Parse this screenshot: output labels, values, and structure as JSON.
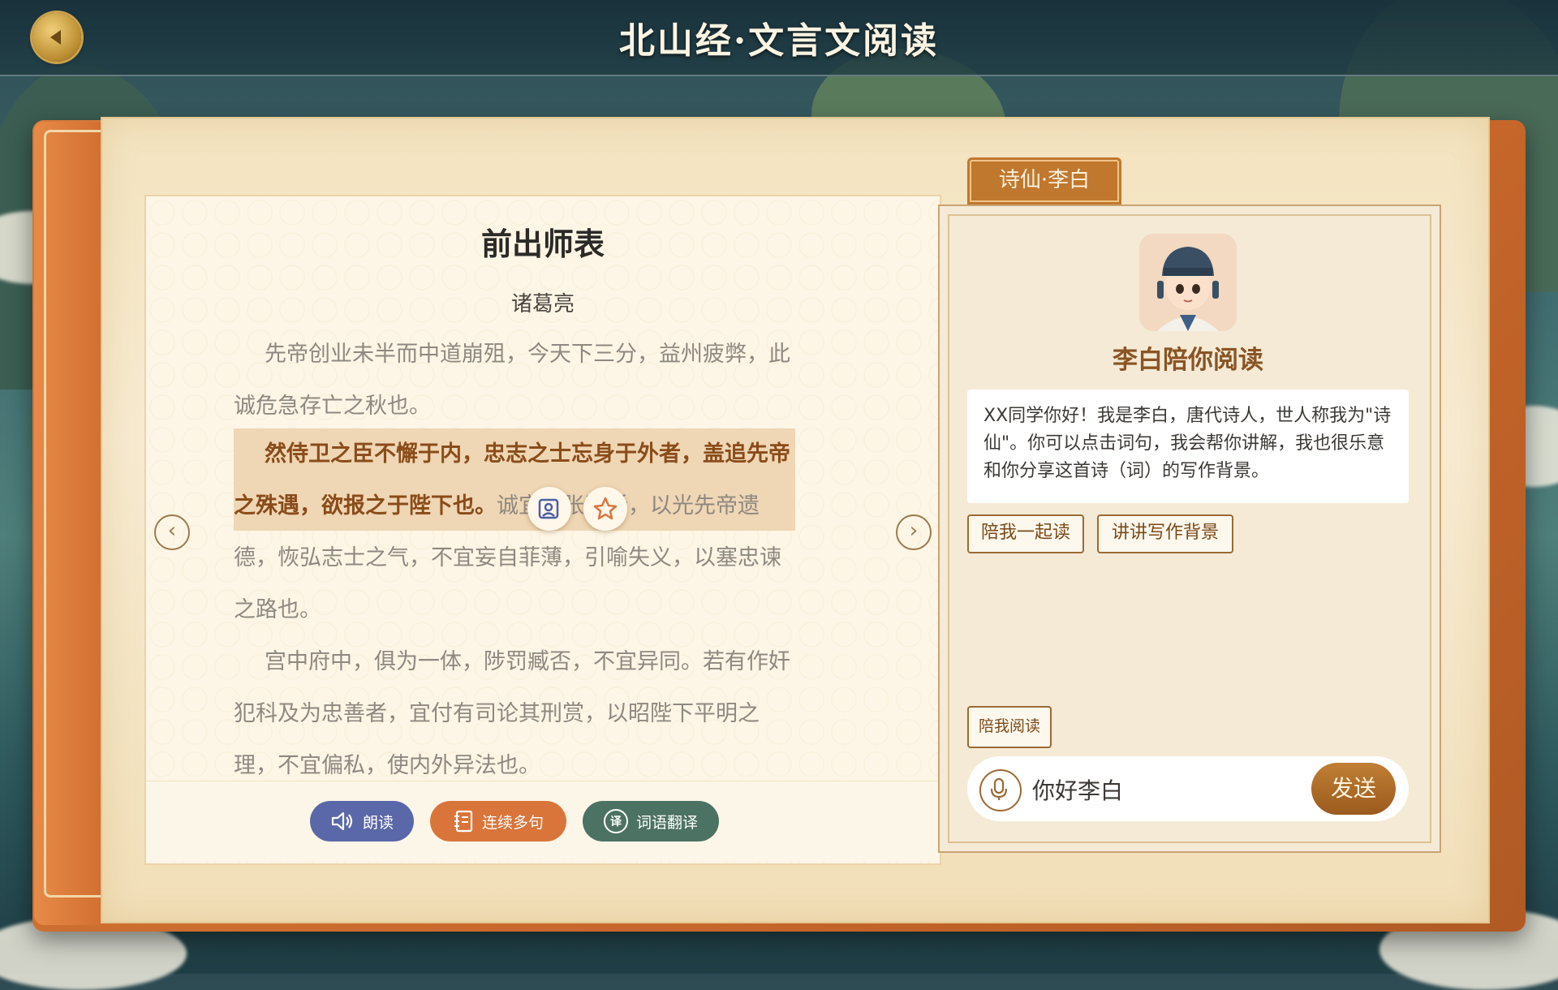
{
  "header": {
    "title": "北山经·文言文阅读",
    "back_icon": "back-arrow-icon"
  },
  "reader": {
    "title": "前出师表",
    "author": "诸葛亮",
    "paragraphs": [
      "先帝创业未半而中道崩殂，今天下三分，益州疲弊，此诚危急存亡之秋也。",
      "然侍卫之臣不懈于内，忠志之士忘身于外者，盖追先帝之殊遇，欲报之于陛下也。",
      "诚宜开张圣听，以光先帝遗德，恢弘志士之气，不宜妄自菲薄，引喻失义，以塞忠谏之路也。",
      "宫中府中，俱为一体，陟罚臧否，不宜异同。若有作奸犯科及为忠善者，宜付有司论其刑赏，以昭陛下平明之理，不宜偏私，使内外异法也。"
    ],
    "highlighted_sentence": "然侍卫之臣不懈于内，忠志之士忘身于外者，盖追先帝之殊遇，欲报之于陛下也。",
    "prev_icon": "chevron-left-icon",
    "next_icon": "chevron-right-icon",
    "actions": {
      "read_aloud": "朗读",
      "continuous": "连续多句",
      "translate": "词语翻译",
      "translate_icon_char": "译"
    }
  },
  "companion": {
    "tab": "诗仙·李白",
    "name": "李白陪你阅读",
    "greeting": "XX同学你好！我是李白，唐代诗人，世人称我为\"诗仙\"。你可以点击词句，我会帮你讲解，我也很乐意和你分享这首诗（词）的写作背景。",
    "options": [
      "陪我一起读",
      "讲讲写作背景"
    ],
    "quick_action": "陪我阅读",
    "input_value": "你好李白",
    "send_label": "发送"
  },
  "colors": {
    "accent": "#c0782e",
    "highlight": "#efd6b4",
    "read_button": "#5a67a8",
    "continuous_button": "#d9753a",
    "translate_button": "#4c7263"
  }
}
